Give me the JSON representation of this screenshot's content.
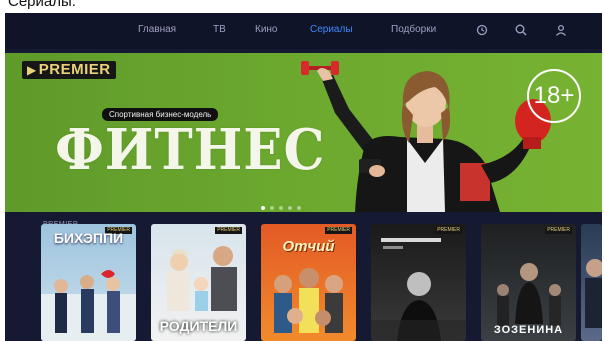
{
  "page": {
    "heading": "Сериалы."
  },
  "nav": {
    "items": [
      {
        "label": "Главная",
        "active": false
      },
      {
        "label": "ТВ",
        "active": false
      },
      {
        "label": "Кино",
        "active": false
      },
      {
        "label": "Сериалы",
        "active": true
      },
      {
        "label": "Подборки",
        "active": false
      }
    ],
    "icons": [
      "history-icon",
      "search-icon",
      "profile-icon"
    ],
    "active_color": "#3f88ff"
  },
  "banner": {
    "brand": "PREMIER",
    "tagline": "Спортивная бизнес-модель",
    "title": "ФИТНЕС",
    "age_rating": "18+",
    "background": "#6ba82e"
  },
  "section": {
    "label": "PREMIER",
    "posters": [
      {
        "title": "БИХЭППИ",
        "corner": "PREMIER"
      },
      {
        "title": "РОДИТЕЛИ",
        "corner": "PREMIER"
      },
      {
        "title": "Отчий",
        "corner": "PREMIER"
      },
      {
        "title": "",
        "corner": "PREMIER"
      },
      {
        "title": "ЗОЗЕНИНА",
        "corner": "PREMIER"
      },
      {
        "title": "",
        "corner": ""
      }
    ]
  }
}
